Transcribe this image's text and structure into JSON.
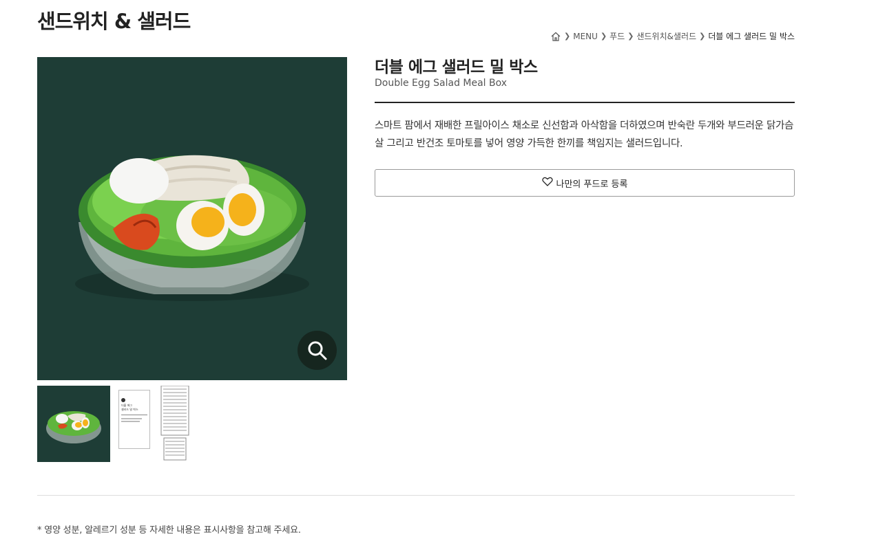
{
  "page": {
    "title": "샌드위치 & 샐러드"
  },
  "breadcrumb": {
    "items": [
      "MENU",
      "푸드",
      "샌드위치&샐러드"
    ],
    "current": "더블 에그 샐러드 밀 박스"
  },
  "product": {
    "name_ko": "더블 에그 샐러드 밀 박스",
    "name_en": "Double Egg Salad Meal Box",
    "description": "스마트 팜에서 재배한 프릴아이스 채소로 신선함과 아삭함을 더하였으며 반숙란 두개와 부드러운 닭가슴살 그리고 반건조 토마토를 넣어 영양 가득한 한끼를 책임지는 샐러드입니다."
  },
  "actions": {
    "favorite_label": "나만의 푸드로 등록"
  },
  "thumbnail_label": {
    "line1": "더블 에그",
    "line2": "샐러드 밀 박스"
  },
  "footnote": "* 영양 성분, 알레르기 성분 등 자세한 내용은 표시사항을 참고해 주세요.",
  "icons": {
    "home": "home-icon",
    "zoom": "search-icon",
    "favorite": "heart-outline-icon",
    "separator": "chevron-right-icon"
  },
  "colors": {
    "image_bg": "#1e3d36",
    "zoom_bg": "#16261f",
    "text": "#222222"
  }
}
